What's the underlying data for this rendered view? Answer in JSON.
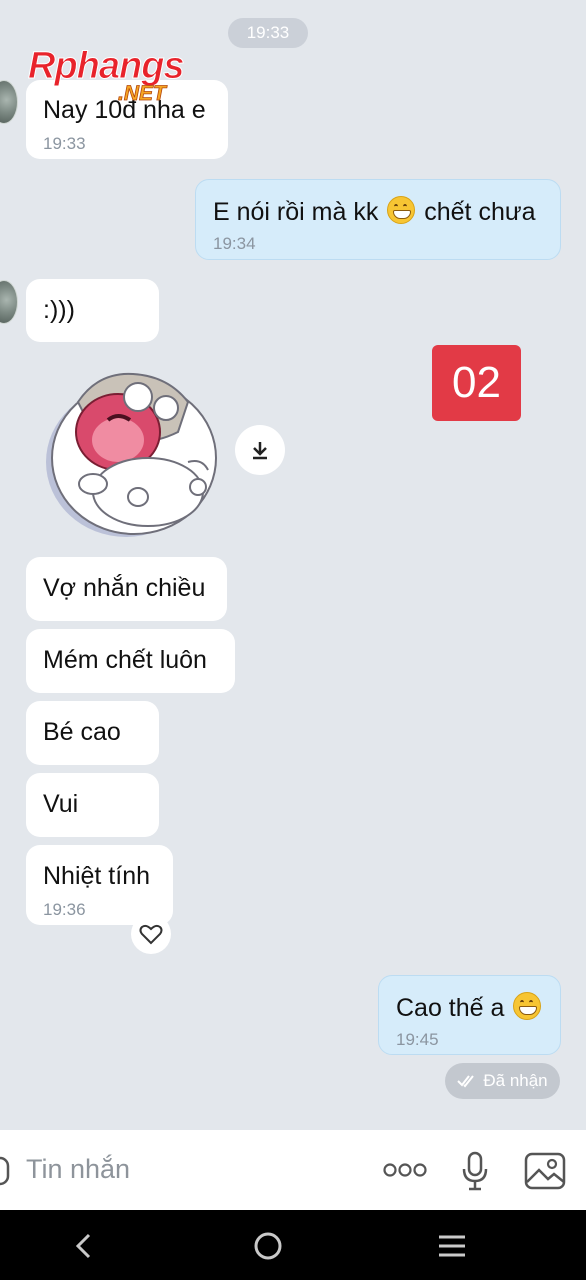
{
  "header": {
    "date_pill": "19:33"
  },
  "watermark": {
    "brand": "Rphangs",
    "suffix": ".NET"
  },
  "messages": [
    {
      "side": "in",
      "text": "Nay 10đ nha e",
      "time": "19:33"
    },
    {
      "side": "out",
      "text": "E nói rồi mà kk",
      "emoji": "grinning-face-emoji",
      "text_after": "chết chưa",
      "time": "19:34"
    },
    {
      "side": "in",
      "text": ":)))"
    },
    {
      "side": "in",
      "type": "sticker",
      "sticker": "laughing-cat-sticker"
    },
    {
      "side": "in",
      "text": "Vợ nhắn chiều"
    },
    {
      "side": "in",
      "text": "Mém chết luôn"
    },
    {
      "side": "in",
      "text": "Bé cao"
    },
    {
      "side": "in",
      "text": "Vui"
    },
    {
      "side": "in",
      "text": "Nhiệt tính",
      "time": "19:36"
    },
    {
      "side": "out",
      "text": "Cao thế a",
      "emoji": "grinning-face-emoji",
      "time": "19:45"
    }
  ],
  "overlay_badge": "02",
  "status": {
    "label": "Đã nhận",
    "icon": "double-check-icon"
  },
  "input": {
    "placeholder": "Tin nhắn"
  },
  "icons": {
    "download": "download-icon",
    "heart": "heart-icon",
    "more": "more-dots-icon",
    "mic": "microphone-icon",
    "image": "image-icon",
    "back": "back-icon",
    "home": "home-icon",
    "menu": "menu-icon"
  },
  "colors": {
    "incoming_bubble": "#ffffff",
    "outgoing_bubble": "#d6ecfa",
    "badge": "#e23a46",
    "background": "#e3e7ec"
  }
}
